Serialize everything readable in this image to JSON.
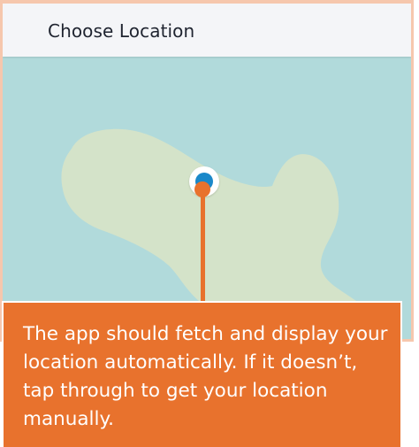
{
  "header": {
    "title": "Choose Location"
  },
  "map": {
    "water_color": "#b1dadb",
    "land_color": "#d4e3c9",
    "icons": {
      "location_pin": "location-pin-icon"
    }
  },
  "callout": {
    "text": "The app should fetch and display your location automatically. If it doesn’t, tap through to get your location manually.",
    "background_color": "#e8722d"
  },
  "colors": {
    "frame_border": "#f6c7ad",
    "header_bg": "#f4f5f8",
    "pin_blue": "#1a88c9",
    "accent_orange": "#e8722d"
  }
}
